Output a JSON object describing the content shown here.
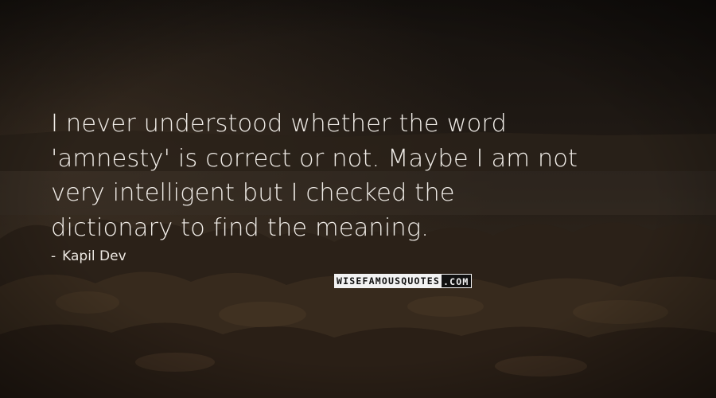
{
  "quote": {
    "lines": [
      "I never understood whether the word",
      "'amnesty' is correct or not. Maybe I am not",
      "very intelligent but I checked the",
      "dictionary to find the meaning."
    ]
  },
  "author": {
    "dash": "-",
    "name": "Kapil Dev"
  },
  "watermark": {
    "part1": "WISEFAMOUSQUOTES",
    "part2": ".COM"
  },
  "colors": {
    "text": "#f1ede8",
    "background": "#1b1713"
  }
}
